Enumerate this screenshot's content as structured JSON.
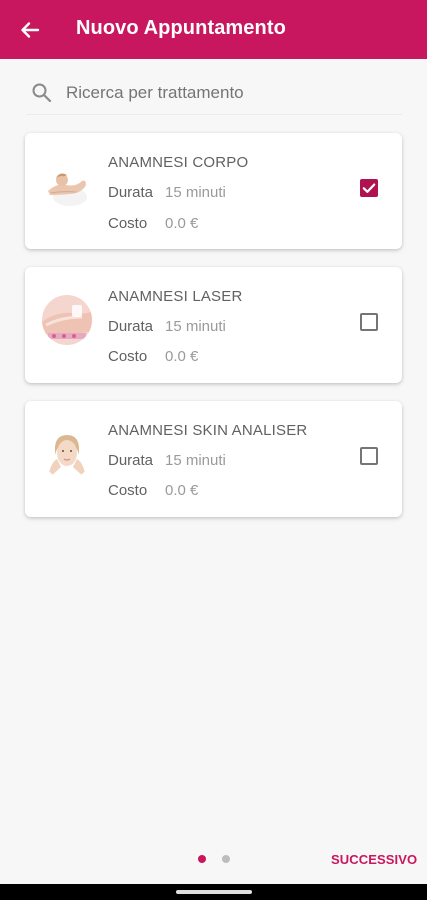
{
  "appbar": {
    "title": "Nuovo Appuntamento",
    "back_icon": "arrow-back-icon",
    "background_color": "#c8175e"
  },
  "search": {
    "placeholder": "Ricerca per trattamento",
    "value": "",
    "icon": "search-icon"
  },
  "treatments": [
    {
      "title": "ANAMNESI CORPO",
      "duration_label": "Durata",
      "duration_value": "15 minuti",
      "cost_label": "Costo",
      "cost_value": "0.0 €",
      "checked": true,
      "image": "body-treatment-photo"
    },
    {
      "title": "ANAMNESI LASER",
      "duration_label": "Durata",
      "duration_value": "15 minuti",
      "cost_label": "Costo",
      "cost_value": "0.0 €",
      "checked": false,
      "image": "laser-treatment-photo"
    },
    {
      "title": "ANAMNESI SKIN ANALISER",
      "duration_label": "Durata",
      "duration_value": "15 minuti",
      "cost_label": "Costo",
      "cost_value": "0.0 €",
      "checked": false,
      "image": "face-skin-photo"
    }
  ],
  "pager": {
    "page_count": 2,
    "current_page": 1,
    "active_color": "#c8175e",
    "inactive_color": "#bdbdbd"
  },
  "footer": {
    "next_label": "SUCCESSIVO"
  }
}
